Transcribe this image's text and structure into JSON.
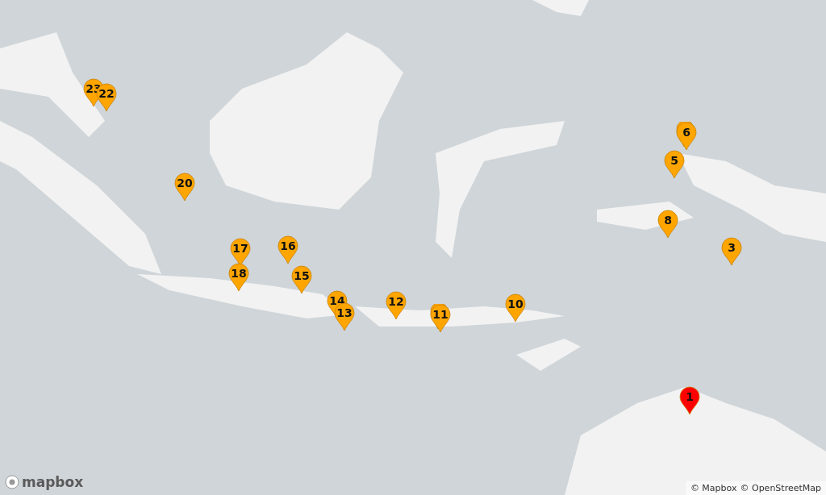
{
  "map": {
    "pins": [
      {
        "kind": "numbered",
        "label": "23",
        "color": "#ffa500"
      },
      {
        "kind": "numbered",
        "label": "22",
        "color": "#ffa500"
      },
      {
        "kind": "stacked",
        "label": "6",
        "color": "#ffa500"
      },
      {
        "kind": "numbered",
        "label": "5",
        "color": "#ffa500"
      },
      {
        "kind": "numbered",
        "label": "20",
        "color": "#ffa500"
      },
      {
        "kind": "numbered",
        "label": "8",
        "color": "#ffa500"
      },
      {
        "kind": "numbered",
        "label": "17",
        "color": "#ffa500"
      },
      {
        "kind": "numbered",
        "label": "16",
        "color": "#ffa500"
      },
      {
        "kind": "numbered",
        "label": "3",
        "color": "#ffa500"
      },
      {
        "kind": "numbered",
        "label": "18",
        "color": "#ffa500"
      },
      {
        "kind": "numbered",
        "label": "15",
        "color": "#ffa500"
      },
      {
        "kind": "numbered",
        "label": "14",
        "color": "#ffa500"
      },
      {
        "kind": "numbered",
        "label": "12",
        "color": "#ffa500"
      },
      {
        "kind": "numbered",
        "label": "10",
        "color": "#ffa500"
      },
      {
        "kind": "numbered",
        "label": "13",
        "color": "#ffa500"
      },
      {
        "kind": "stacked",
        "label": "11",
        "color": "#ffa500"
      },
      {
        "kind": "numbered",
        "label": "1",
        "color": "#ff0000"
      }
    ]
  },
  "logo": {
    "text": "mapbox"
  },
  "attribution": [
    "© Mapbox",
    "© OpenStreetMap"
  ]
}
